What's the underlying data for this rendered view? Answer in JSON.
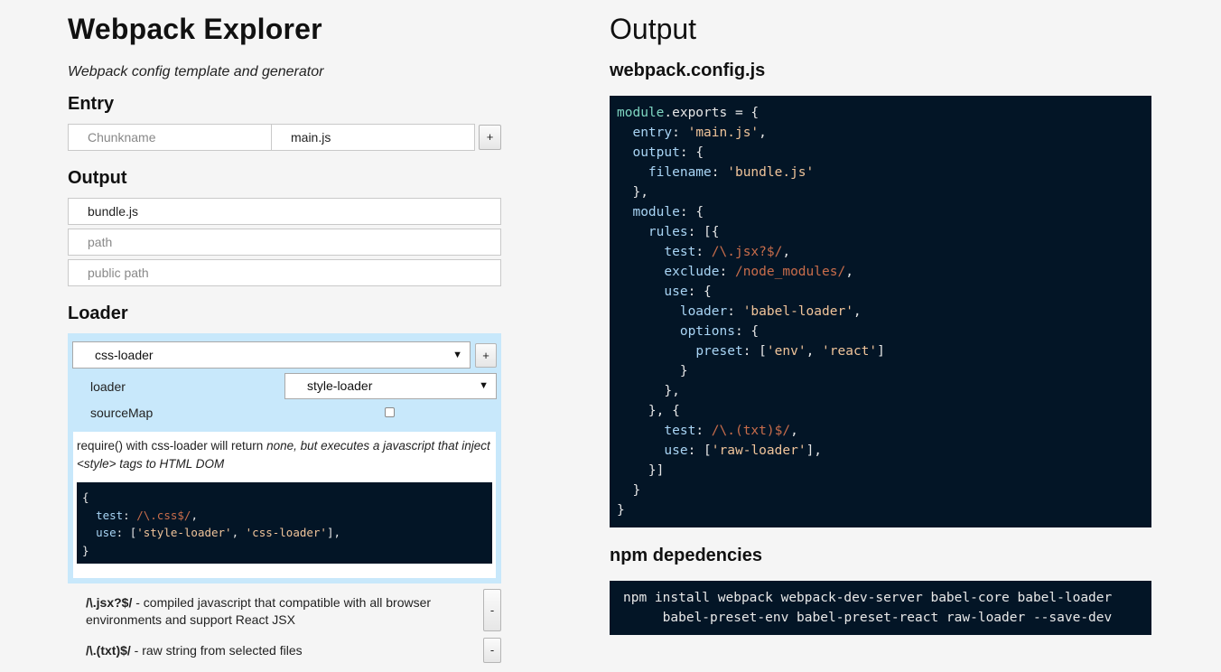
{
  "left": {
    "title": "Webpack Explorer",
    "subtitle": "Webpack config template and generator",
    "entry": {
      "heading": "Entry",
      "chunkname_placeholder": "Chunkname",
      "file_value": "main.js",
      "add_label": "+"
    },
    "output": {
      "heading": "Output",
      "filename_value": "bundle.js",
      "path_placeholder": "path",
      "public_path_placeholder": "public path"
    },
    "loader": {
      "heading": "Loader",
      "selected": "css-loader",
      "add_label": "+",
      "option_loader_label": "loader",
      "option_loader_value": "style-loader",
      "option_sourcemap_label": "sourceMap",
      "sourcemap_checked": false,
      "description_prefix": "require() with css-loader will return ",
      "description_italic": "none, but executes a javascript that inject <style> tags to HTML DOM",
      "code": {
        "open": "{",
        "test_key": "test",
        "test_value": "/\\.css$/",
        "use_key": "use",
        "use_value_1": "'style-loader'",
        "use_value_2": "'css-loader'",
        "close": "}"
      }
    },
    "rules": [
      {
        "pattern": "/\\.jsx?$/",
        "description": " - compiled javascript that compatible with all browser environments and support React JSX",
        "remove_label": "-"
      },
      {
        "pattern": "/\\.(txt)$/",
        "description": " - raw string from selected files",
        "remove_label": "-"
      }
    ]
  },
  "right": {
    "title": "Output",
    "config_heading": "webpack.config.js",
    "config": {
      "module_kw": "module",
      "exports": ".exports = {",
      "entry_key": "entry",
      "entry_value": "'main.js'",
      "output_key": "output",
      "filename_key": "filename",
      "filename_value": "'bundle.js'",
      "module_key": "module",
      "rules_key": "rules",
      "test_key": "test",
      "rule1_test": "/\\.jsx?$/",
      "exclude_key": "exclude",
      "exclude_value": "/node_modules/",
      "use_key": "use",
      "loader_key": "loader",
      "loader_value": "'babel-loader'",
      "options_key": "options",
      "preset_key": "preset",
      "preset_v1": "'env'",
      "preset_v2": "'react'",
      "rule2_test": "/\\.(txt)$/",
      "rule2_use": "'raw-loader'"
    },
    "npm_heading": "npm depedencies",
    "npm_line1": "npm install webpack webpack-dev-server babel-core babel-loader",
    "npm_line2": "babel-preset-env babel-preset-react raw-loader --save-dev"
  }
}
